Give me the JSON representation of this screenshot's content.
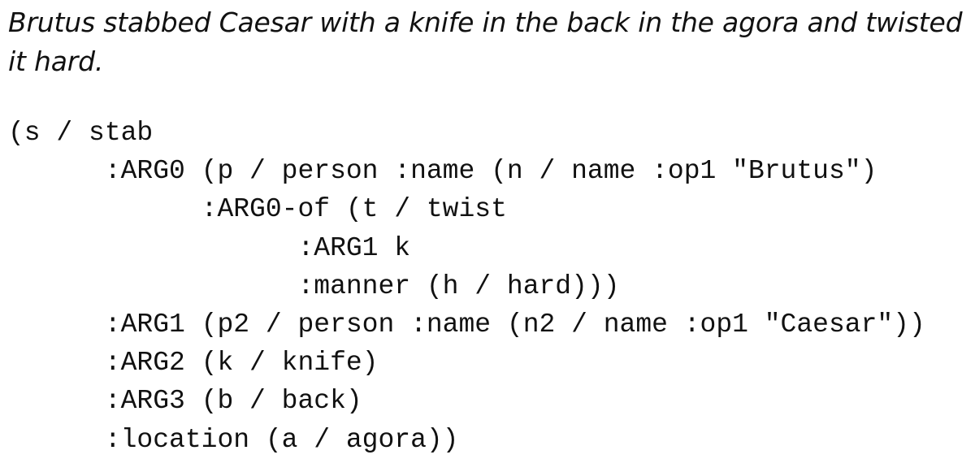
{
  "sentence": "Brutus stabbed Caesar with a knife in the back in the agora and twisted it hard.",
  "amr_lines": [
    "(s / stab",
    "      :ARG0 (p / person :name (n / name :op1 \"Brutus\")",
    "            :ARG0-of (t / twist",
    "                  :ARG1 k",
    "                  :manner (h / hard)))",
    "      :ARG1 (p2 / person :name (n2 / name :op1 \"Caesar\"))",
    "      :ARG2 (k / knife)",
    "      :ARG3 (b / back)",
    "      :location (a / agora))"
  ]
}
